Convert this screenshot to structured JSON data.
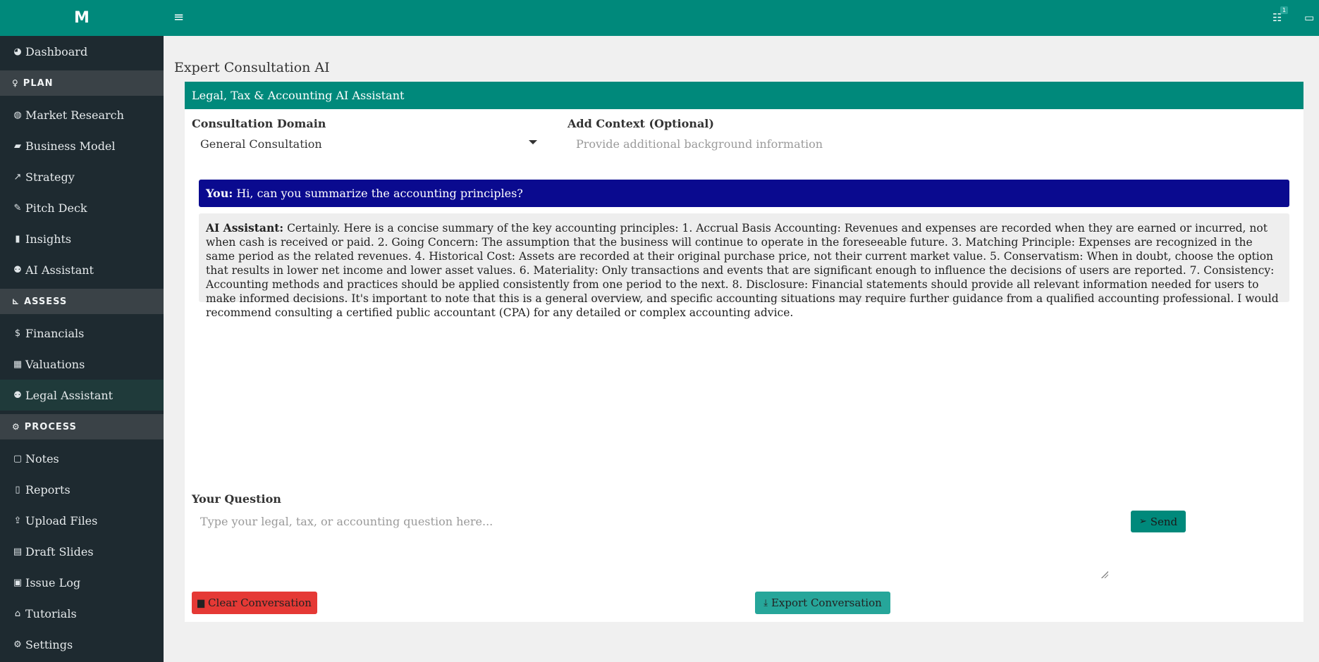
{
  "brand": {
    "logo": "M"
  },
  "sidebar": {
    "items_top": [
      {
        "icon": "dashboard-icon",
        "glyph": "◕",
        "label": "Dashboard"
      }
    ],
    "plan": {
      "section_label": "PLAN",
      "section_glyph": "♀",
      "items": [
        {
          "icon": "globe-icon",
          "glyph": "◍",
          "label": "Market Research"
        },
        {
          "icon": "briefcase-icon",
          "glyph": "▰",
          "label": "Business Model"
        },
        {
          "icon": "line-chart-icon",
          "glyph": "↗",
          "label": "Strategy"
        },
        {
          "icon": "pencil-icon",
          "glyph": "✎",
          "label": "Pitch Deck"
        },
        {
          "icon": "bar-chart-icon",
          "glyph": "▮",
          "label": "Insights"
        },
        {
          "icon": "robot-icon",
          "glyph": "⚉",
          "label": "AI Assistant"
        }
      ]
    },
    "assess": {
      "section_label": "ASSESS",
      "section_glyph": "⊾",
      "items": [
        {
          "icon": "dollar-icon",
          "glyph": "$",
          "label": "Financials"
        },
        {
          "icon": "calculator-icon",
          "glyph": "▦",
          "label": "Valuations"
        },
        {
          "icon": "robot-icon",
          "glyph": "⚉",
          "label": "Legal Assistant"
        }
      ]
    },
    "process": {
      "section_label": "PROCESS",
      "section_glyph": "⚙",
      "items": [
        {
          "icon": "note-icon",
          "glyph": "▢",
          "label": "Notes"
        },
        {
          "icon": "file-icon",
          "glyph": "▯",
          "label": "Reports"
        },
        {
          "icon": "upload-icon",
          "glyph": "⇪",
          "label": "Upload Files"
        },
        {
          "icon": "slides-icon",
          "glyph": "▤",
          "label": "Draft Slides"
        },
        {
          "icon": "clipboard-icon",
          "glyph": "▣",
          "label": "Issue Log"
        },
        {
          "icon": "institution-icon",
          "glyph": "⌂",
          "label": "Tutorials"
        },
        {
          "icon": "gear-icon",
          "glyph": "⚙",
          "label": "Settings"
        }
      ]
    }
  },
  "topbar": {
    "menu_glyph": "≡",
    "tasks_glyph": "☷",
    "tasks_badge": "1",
    "card_glyph": "▭"
  },
  "page": {
    "title": "Expert Consultation AI"
  },
  "card": {
    "header": "Legal, Tax & Accounting AI Assistant",
    "domain_label": "Consultation Domain",
    "domain_value": "General Consultation",
    "context_label": "Add Context (Optional)",
    "context_placeholder": "Provide additional background information",
    "user_prefix": "You:",
    "user_message": "Hi, can you summarize the accounting principles?",
    "ai_prefix": "AI Assistant:",
    "ai_message": "Certainly. Here is a concise summary of the key accounting principles: 1. Accrual Basis Accounting: Revenues and expenses are recorded when they are earned or incurred, not when cash is received or paid. 2. Going Concern: The assumption that the business will continue to operate in the foreseeable future. 3. Matching Principle: Expenses are recognized in the same period as the related revenues. 4. Historical Cost: Assets are recorded at their original purchase price, not their current market value. 5. Conservatism: When in doubt, choose the option that results in lower net income and lower asset values. 6. Materiality: Only transactions and events that are significant enough to influence the decisions of users are reported. 7. Consistency: Accounting methods and practices should be applied consistently from one period to the next. 8. Disclosure: Financial statements should provide all relevant information needed for users to make informed decisions. It's important to note that this is a general overview, and specific accounting situations may require further guidance from a qualified accounting professional. I would recommend consulting a certified public accountant (CPA) for any detailed or complex accounting advice.",
    "question_label": "Your Question",
    "question_placeholder": "Type your legal, tax, or accounting question here...",
    "send_label": "Send",
    "send_glyph": "➢",
    "clear_label": "Clear Conversation",
    "clear_glyph": "▆",
    "export_label": "Export Conversation",
    "export_glyph": "⤓"
  }
}
